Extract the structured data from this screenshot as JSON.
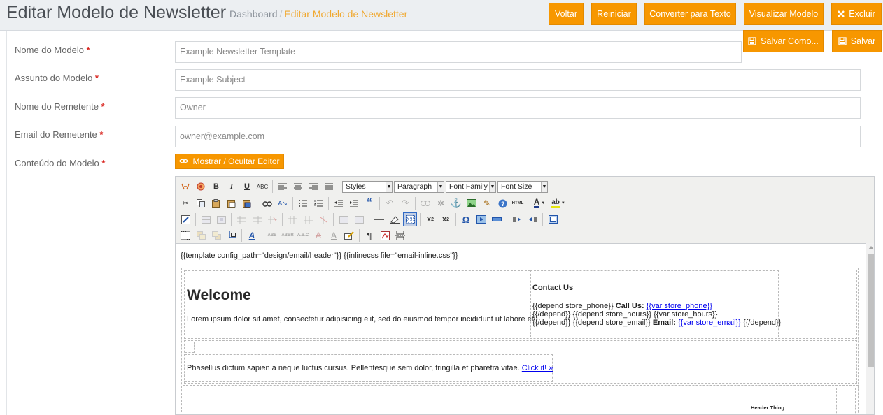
{
  "header": {
    "title": "Editar Modelo de Newsletter",
    "breadcrumb": {
      "home": "Dashboard",
      "separator": "/",
      "current": "Editar Modelo de Newsletter"
    },
    "buttons": {
      "back": "Voltar",
      "reset": "Reiniciar",
      "convert": "Converter para Texto",
      "preview": "Visualizar Modelo",
      "delete": "Excluir",
      "save_as": "Salvar Como...",
      "save": "Salvar"
    }
  },
  "form": {
    "name": {
      "label": "Nome do Modelo",
      "value": "Example Newsletter Template"
    },
    "subject": {
      "label": "Assunto do Modelo",
      "value": "Example Subject"
    },
    "sender_name": {
      "label": "Nome do Remetente",
      "value": "Owner"
    },
    "sender_email": {
      "label": "Email do Remetente",
      "value": "owner@example.com"
    },
    "content": {
      "label": "Conteúdo do Modelo"
    },
    "required_mark": "*",
    "toggle_editor": "Mostrar / Ocultar Editor"
  },
  "editor": {
    "selects": {
      "styles": "Styles",
      "paragraph": "Paragraph",
      "font_family": "Font Family",
      "font_size": "Font Size"
    },
    "body": {
      "line1": "{{template config_path=\"design/email/header\"}} {{inlinecss file=\"email-inline.css\"}}",
      "welcome": "Welcome",
      "lorem": "Lorem ipsum dolor sit amet, consectetur adipisicing elit, sed do eiusmod tempor incididunt ut labore et.",
      "contact_title": "Contact Us",
      "c1a": "{{depend store_phone}}",
      "c1b": "Call Us:",
      "c1c": "{{var store_phone}}",
      "c2": "{{/depend}} {{depend store_hours}} {{var store_hours}}",
      "c3a": "{{/depend}} {{depend store_email}}",
      "c3b": "Email:",
      "c3c": "{{var store_email}}",
      "c3d": "{{/depend}}",
      "phasellus": "Phasellus dictum sapien a neque luctus cursus. Pellentesque sem dolor, fringilla et pharetra vitae.",
      "click": "Click it! »",
      "header_thing": "Header Thing"
    }
  },
  "colors": {
    "accent": "#f79700",
    "breadcrumb_current": "#f0a830",
    "required": "#d9231d"
  }
}
